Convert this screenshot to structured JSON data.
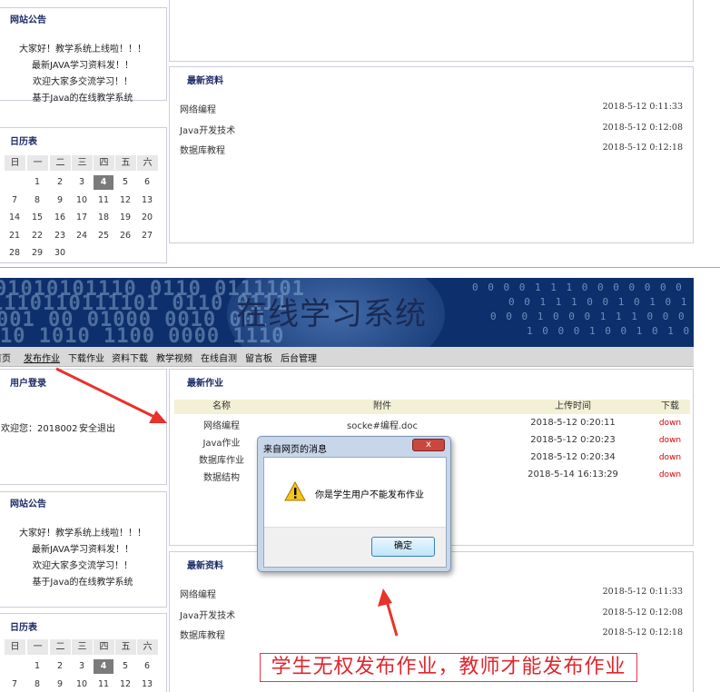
{
  "top": {
    "notice": {
      "title": "网站公告",
      "lines": [
        "大家好！教学系统上线啦！！！",
        "最新JAVA学习资料发！！",
        "欢迎大家多交流学习！！",
        "基于Java的在线教学系统"
      ]
    },
    "calendar": {
      "title": "日历表",
      "weekdays": [
        "日",
        "一",
        "二",
        "三",
        "四",
        "五",
        "六"
      ],
      "rows": [
        [
          "",
          "1",
          "2",
          "3",
          "4",
          "5",
          "6"
        ],
        [
          "7",
          "8",
          "9",
          "10",
          "11",
          "12",
          "13"
        ],
        [
          "14",
          "15",
          "16",
          "17",
          "18",
          "19",
          "20"
        ],
        [
          "21",
          "22",
          "23",
          "24",
          "25",
          "26",
          "27"
        ],
        [
          "28",
          "29",
          "30",
          "",
          "",
          "",
          ""
        ]
      ],
      "today": "4"
    },
    "resources": {
      "title": "最新资料",
      "items": [
        {
          "name": "网络编程",
          "time": "2018-5-12 0:11:33"
        },
        {
          "name": "Java开发技术",
          "time": "2018-5-12 0:12:08"
        },
        {
          "name": "数据库教程",
          "time": "2018-5-12 0:12:18"
        }
      ]
    }
  },
  "banner": {
    "title": "在线学习系统"
  },
  "nav": {
    "items": [
      "首页",
      "发布作业",
      "下载作业",
      "资料下载",
      "教学视频",
      "在线自测",
      "留言板",
      "后台管理"
    ]
  },
  "login": {
    "title": "用户登录",
    "welcome": "欢迎您：2018002",
    "logout": "安全退出"
  },
  "homework": {
    "title": "最新作业",
    "headers": [
      "名称",
      "附件",
      "上传时间",
      "下载"
    ],
    "rows": [
      {
        "name": "网络编程",
        "file": "socke#编程.doc",
        "time": "2018-5-12 0:20:11",
        "down": "down"
      },
      {
        "name": "Java作业",
        "file": "",
        "time": "2018-5-12 0:20:23",
        "down": "down"
      },
      {
        "name": "数据库作业",
        "file": "",
        "time": "2018-5-12 0:20:34",
        "down": "down"
      },
      {
        "name": "数据结构",
        "file": "",
        "time": "2018-5-14 16:13:29",
        "down": "down"
      }
    ]
  },
  "bottom": {
    "notice": {
      "title": "网站公告",
      "lines": [
        "大家好！教学系统上线啦！！！",
        "最新JAVA学习资料发！！",
        "欢迎大家多交流学习！！",
        "基于Java的在线教学系统"
      ]
    },
    "calendar": {
      "title": "日历表",
      "weekdays": [
        "日",
        "一",
        "二",
        "三",
        "四",
        "五",
        "六"
      ],
      "rows": [
        [
          "",
          "1",
          "2",
          "3",
          "4",
          "5",
          "6"
        ],
        [
          "7",
          "8",
          "9",
          "10",
          "11",
          "12",
          "13"
        ]
      ],
      "today": "4"
    },
    "resources": {
      "title": "最新资料",
      "items": [
        {
          "name": "网络编程",
          "time": "2018-5-12 0:11:33"
        },
        {
          "name": "Java开发技术",
          "time": "2018-5-12 0:12:08"
        },
        {
          "name": "数据库教程",
          "time": "2018-5-12 0:12:18"
        }
      ]
    }
  },
  "dialog": {
    "title": "来自网页的消息",
    "close": "x",
    "message": "你是学生用户不能发布作业",
    "ok": "确定"
  },
  "annotation": {
    "text": "学生无权发布作业，教师才能发布作业"
  },
  "colors": {
    "accent_title": "#1a2a66",
    "banner_bg": "#0d2f6b",
    "arrow": "#e8322a",
    "down_link": "#dd0000"
  }
}
